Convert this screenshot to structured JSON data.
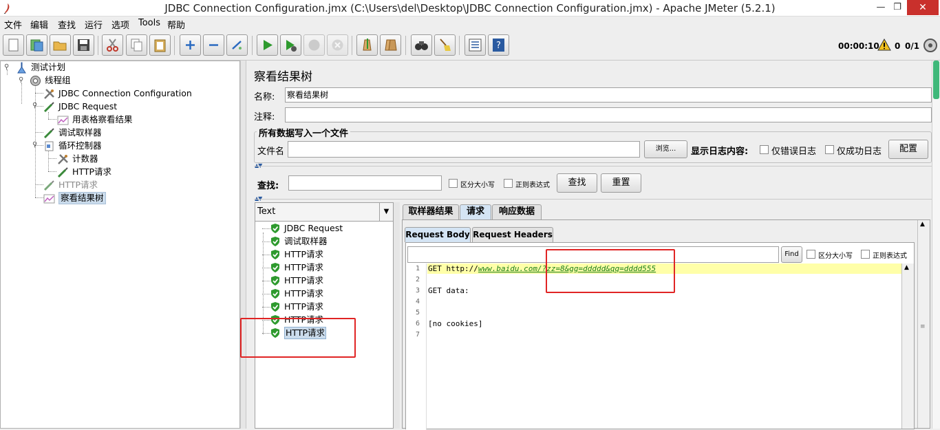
{
  "window": {
    "title": "JDBC Connection Configuration.jmx (C:\\Users\\del\\Desktop\\JDBC Connection Configuration.jmx) - Apache JMeter (5.2.1)",
    "min": "—",
    "max": "❐",
    "close": "✕"
  },
  "menu": [
    "文件",
    "编辑",
    "查找",
    "运行",
    "选项",
    "Tools",
    "帮助"
  ],
  "toolbar": {
    "icons": [
      "new-icon",
      "templates-icon",
      "open-icon",
      "save-icon",
      "cut-icon",
      "copy-icon",
      "paste-icon",
      "expand-icon",
      "collapse-icon",
      "toggle-icon",
      "start-icon",
      "start-no-pause-icon",
      "stop-icon",
      "shutdown-icon",
      "clear-icon",
      "clear-all-icon",
      "search-icon",
      "reset-search-icon",
      "function-helper-icon",
      "help-icon"
    ],
    "timer": "00:00:10",
    "warnings": "0",
    "threads": "0/1"
  },
  "tree": {
    "items": [
      {
        "label": "测试计划",
        "icon": "test-plan-icon"
      },
      {
        "label": "线程组",
        "icon": "thread-group-icon"
      },
      {
        "label": "JDBC Connection Configuration",
        "icon": "config-element-icon"
      },
      {
        "label": "JDBC Request",
        "icon": "sampler-icon"
      },
      {
        "label": "用表格察看结果",
        "icon": "listener-icon"
      },
      {
        "label": "调试取样器",
        "icon": "sampler-icon"
      },
      {
        "label": "循环控制器",
        "icon": "controller-icon"
      },
      {
        "label": "计数器",
        "icon": "config-element-icon"
      },
      {
        "label": "HTTP请求",
        "icon": "sampler-icon"
      },
      {
        "label": "HTTP请求",
        "icon": "sampler-icon"
      },
      {
        "label": "察看结果树",
        "icon": "listener-icon"
      }
    ]
  },
  "panel": {
    "title": "察看结果树",
    "name_label": "名称:",
    "name_value": "察看结果树",
    "comment_label": "注释:",
    "comment_value": "",
    "file_group_title": "所有数据写入一个文件",
    "filename_label": "文件名",
    "filename_value": "",
    "browse_button": "浏览...",
    "log_content_label": "显示日志内容:",
    "errors_only_label": "仅错误日志",
    "success_only_label": "仅成功日志",
    "configure_button": "配置",
    "search_label": "查找:",
    "search_value": "",
    "case_sensitive_label": "区分大小写",
    "regex_label": "正则表达式",
    "search_button": "查找",
    "reset_button": "重置"
  },
  "results": {
    "renderer": "Text",
    "items": [
      "JDBC Request",
      "调试取样器",
      "HTTP请求",
      "HTTP请求",
      "HTTP请求",
      "HTTP请求",
      "HTTP请求",
      "HTTP请求",
      "HTTP请求"
    ]
  },
  "detail": {
    "tabs": [
      "取样器结果",
      "请求",
      "响应数据"
    ],
    "active_tab": "请求",
    "subtabs": [
      "Request Body",
      "Request Headers"
    ],
    "active_subtab": "Request Body",
    "find_value": "",
    "find_button": "Find",
    "case_label": "区分大小写",
    "regex_label": "正则表达式",
    "lines": [
      {
        "num": "1",
        "prefix": "GET http://",
        "link": "www.baidu.com/?zz=8&gg=ddddd&qq=dddd555"
      },
      {
        "num": "2",
        "text": ""
      },
      {
        "num": "3",
        "text": "GET data:"
      },
      {
        "num": "4",
        "text": ""
      },
      {
        "num": "5",
        "text": ""
      },
      {
        "num": "6",
        "text": "[no cookies]"
      },
      {
        "num": "7",
        "text": ""
      }
    ]
  },
  "colors": {
    "highlight_box": "#e02424",
    "line_highlight": "#ffffa8",
    "link": "#1a7f1a",
    "selection": "#cbdcec"
  }
}
